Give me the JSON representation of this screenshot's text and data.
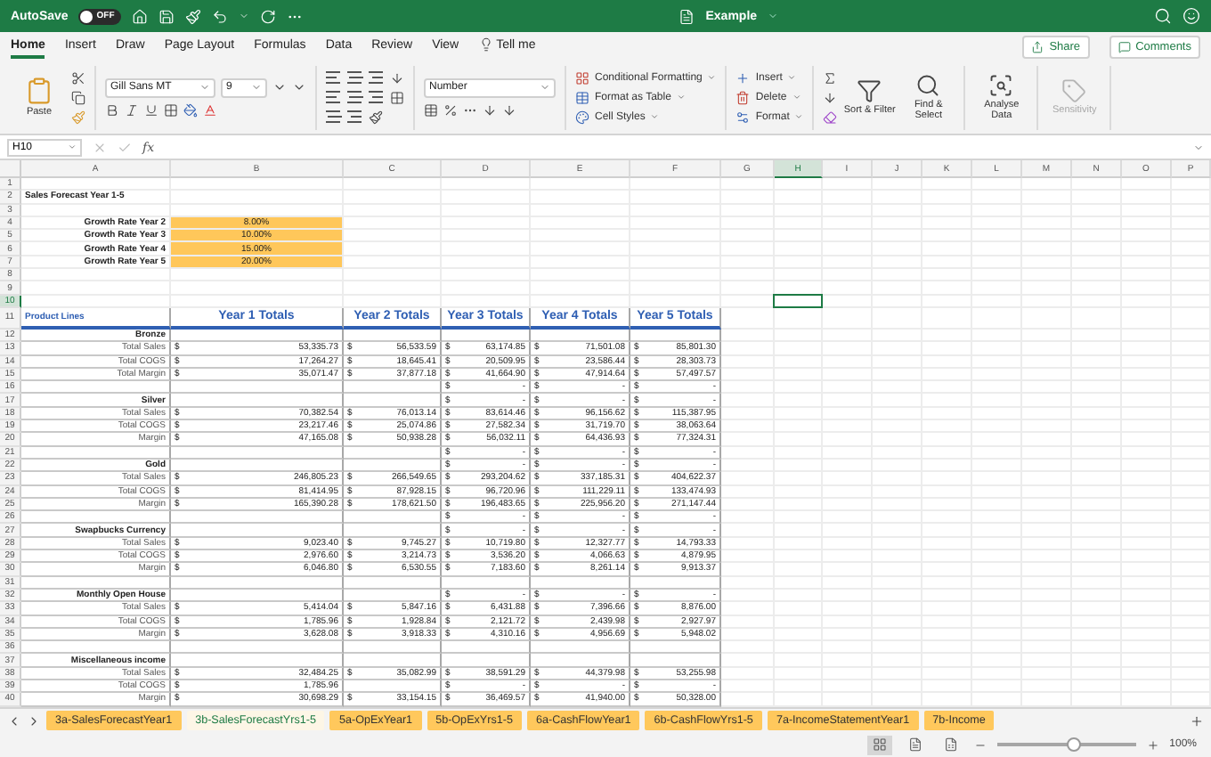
{
  "title_bar": {
    "autosave": "AutoSave",
    "autosave_on": false,
    "toggle_label": "OFF",
    "title": "Example"
  },
  "ribbon": {
    "tabs": [
      {
        "label": "Home",
        "selected": true
      },
      {
        "label": "Insert",
        "selected": false
      },
      {
        "label": "Draw",
        "selected": false
      },
      {
        "label": "Page Layout",
        "selected": false
      },
      {
        "label": "Formulas",
        "selected": false
      },
      {
        "label": "Data",
        "selected": false
      },
      {
        "label": "Review",
        "selected": false
      },
      {
        "label": "View",
        "selected": false
      },
      {
        "label": "Tell me",
        "selected": false
      }
    ],
    "share": "Share",
    "comments": "Comments",
    "paste": "Paste",
    "font": "Gill Sans MT",
    "font_size": "9",
    "number_format": "Number",
    "styles": [
      {
        "kind": "conditional",
        "label": "Conditional Formatting"
      },
      {
        "kind": "table",
        "label": "Format as Table"
      },
      {
        "kind": "cellstyles",
        "label": "Cell Styles"
      }
    ],
    "cells": [
      {
        "kind": "insert",
        "label": "Insert"
      },
      {
        "kind": "delete",
        "label": "Delete"
      },
      {
        "kind": "format",
        "label": "Format"
      }
    ],
    "big_buttons": [
      {
        "kind": "sort",
        "label": "Sort & Filter",
        "disabled": false
      },
      {
        "kind": "find",
        "label": "Find & Select",
        "disabled": false
      },
      {
        "kind": "analyse",
        "label": "Analyse Data",
        "disabled": false
      },
      {
        "kind": "sensitivity",
        "label": "Sensitivity",
        "disabled": true
      }
    ]
  },
  "formula_bar": {
    "name_box": "H10",
    "fx": "fx"
  },
  "sheet": {
    "columns": [
      {
        "label": "A",
        "selected": false
      },
      {
        "label": "B",
        "selected": false
      },
      {
        "label": "C",
        "selected": false
      },
      {
        "label": "D",
        "selected": false
      },
      {
        "label": "E",
        "selected": false
      },
      {
        "label": "F",
        "selected": false
      },
      {
        "label": "G",
        "selected": false
      },
      {
        "label": "H",
        "selected": true
      },
      {
        "label": "I",
        "selected": false
      },
      {
        "label": "J",
        "selected": false
      },
      {
        "label": "K",
        "selected": false
      },
      {
        "label": "L",
        "selected": false
      },
      {
        "label": "M",
        "selected": false
      },
      {
        "label": "N",
        "selected": false
      },
      {
        "label": "O",
        "selected": false
      },
      {
        "label": "P",
        "selected": false
      }
    ],
    "rows": [
      {
        "number": "1",
        "selected": false,
        "kind": "blank"
      },
      {
        "number": "2",
        "selected": false,
        "kind": "title",
        "text": "Sales Forecast Year 1-5"
      },
      {
        "number": "3",
        "selected": false,
        "kind": "blank"
      },
      {
        "number": "4",
        "selected": false,
        "kind": "rate",
        "label": "Growth Rate Year 2",
        "value": "8.00%"
      },
      {
        "number": "5",
        "selected": false,
        "kind": "rate",
        "label": "Growth Rate Year 3",
        "value": "10.00%"
      },
      {
        "number": "6",
        "selected": false,
        "kind": "rate",
        "label": "Growth Rate Year 4",
        "value": "15.00%"
      },
      {
        "number": "7",
        "selected": false,
        "kind": "rate",
        "label": "Growth Rate Year 5",
        "value": "20.00%"
      },
      {
        "number": "8",
        "selected": false,
        "kind": "blank"
      },
      {
        "number": "9",
        "selected": false,
        "kind": "blank"
      },
      {
        "number": "10",
        "selected": true,
        "kind": "blank"
      },
      {
        "number": "11",
        "selected": false,
        "kind": "header",
        "label": "Product Lines",
        "headers": [
          "Year 1 Totals",
          "Year 2 Totals",
          "Year 3 Totals",
          "Year 4 Totals",
          "Year 5 Totals"
        ]
      },
      {
        "number": "12",
        "selected": false,
        "kind": "group",
        "label": "Bronze"
      },
      {
        "number": "13",
        "selected": false,
        "kind": "data",
        "label": "Total Sales",
        "cells": [
          {
            "cur": "$",
            "v": "53,335.73"
          },
          {
            "cur": "$",
            "v": "56,533.59"
          },
          {
            "cur": "$",
            "v": "63,174.85"
          },
          {
            "cur": "$",
            "v": "71,501.08"
          },
          {
            "cur": "$",
            "v": "85,801.30"
          }
        ]
      },
      {
        "number": "14",
        "selected": false,
        "kind": "data",
        "label": "Total COGS",
        "cells": [
          {
            "cur": "$",
            "v": "17,264.27"
          },
          {
            "cur": "$",
            "v": "18,645.41"
          },
          {
            "cur": "$",
            "v": "20,509.95"
          },
          {
            "cur": "$",
            "v": "23,586.44"
          },
          {
            "cur": "$",
            "v": "28,303.73"
          }
        ]
      },
      {
        "number": "15",
        "selected": false,
        "kind": "data",
        "label": "Total Margin",
        "cells": [
          {
            "cur": "$",
            "v": "35,071.47"
          },
          {
            "cur": "$",
            "v": "37,877.18"
          },
          {
            "cur": "$",
            "v": "41,664.90"
          },
          {
            "cur": "$",
            "v": "47,914.64"
          },
          {
            "cur": "$",
            "v": "57,497.57"
          }
        ]
      },
      {
        "number": "16",
        "selected": false,
        "kind": "data",
        "cells": [
          null,
          null,
          {
            "cur": "$",
            "v": "-"
          },
          {
            "cur": "$",
            "v": "-"
          },
          {
            "cur": "$",
            "v": "-"
          }
        ]
      },
      {
        "number": "17",
        "selected": false,
        "kind": "group",
        "label": "Silver",
        "cells": [
          null,
          null,
          {
            "cur": "$",
            "v": "-"
          },
          {
            "cur": "$",
            "v": "-"
          },
          {
            "cur": "$",
            "v": "-"
          }
        ]
      },
      {
        "number": "18",
        "selected": false,
        "kind": "data",
        "label": "Total Sales",
        "cells": [
          {
            "cur": "$",
            "v": "70,382.54"
          },
          {
            "cur": "$",
            "v": "76,013.14"
          },
          {
            "cur": "$",
            "v": "83,614.46"
          },
          {
            "cur": "$",
            "v": "96,156.62"
          },
          {
            "cur": "$",
            "v": "115,387.95"
          }
        ]
      },
      {
        "number": "19",
        "selected": false,
        "kind": "data",
        "label": "Total COGS",
        "cells": [
          {
            "cur": "$",
            "v": "23,217.46"
          },
          {
            "cur": "$",
            "v": "25,074.86"
          },
          {
            "cur": "$",
            "v": "27,582.34"
          },
          {
            "cur": "$",
            "v": "31,719.70"
          },
          {
            "cur": "$",
            "v": "38,063.64"
          }
        ]
      },
      {
        "number": "20",
        "selected": false,
        "kind": "data",
        "label": "Margin",
        "cells": [
          {
            "cur": "$",
            "v": "47,165.08"
          },
          {
            "cur": "$",
            "v": "50,938.28"
          },
          {
            "cur": "$",
            "v": "56,032.11"
          },
          {
            "cur": "$",
            "v": "64,436.93"
          },
          {
            "cur": "$",
            "v": "77,324.31"
          }
        ]
      },
      {
        "number": "21",
        "selected": false,
        "kind": "data",
        "cells": [
          null,
          null,
          {
            "cur": "$",
            "v": "-"
          },
          {
            "cur": "$",
            "v": "-"
          },
          {
            "cur": "$",
            "v": "-"
          }
        ]
      },
      {
        "number": "22",
        "selected": false,
        "kind": "group",
        "label": "Gold",
        "cells": [
          null,
          null,
          {
            "cur": "$",
            "v": "-"
          },
          {
            "cur": "$",
            "v": "-"
          },
          {
            "cur": "$",
            "v": "-"
          }
        ]
      },
      {
        "number": "23",
        "selected": false,
        "kind": "data",
        "label": "Total Sales",
        "cells": [
          {
            "cur": "$",
            "v": "246,805.23"
          },
          {
            "cur": "$",
            "v": "266,549.65"
          },
          {
            "cur": "$",
            "v": "293,204.62"
          },
          {
            "cur": "$",
            "v": "337,185.31"
          },
          {
            "cur": "$",
            "v": "404,622.37"
          }
        ]
      },
      {
        "number": "24",
        "selected": false,
        "kind": "data",
        "label": "Total COGS",
        "cells": [
          {
            "cur": "$",
            "v": "81,414.95"
          },
          {
            "cur": "$",
            "v": "87,928.15"
          },
          {
            "cur": "$",
            "v": "96,720.96"
          },
          {
            "cur": "$",
            "v": "111,229.11"
          },
          {
            "cur": "$",
            "v": "133,474.93"
          }
        ]
      },
      {
        "number": "25",
        "selected": false,
        "kind": "data",
        "label": "Margin",
        "cells": [
          {
            "cur": "$",
            "v": "165,390.28"
          },
          {
            "cur": "$",
            "v": "178,621.50"
          },
          {
            "cur": "$",
            "v": "196,483.65"
          },
          {
            "cur": "$",
            "v": "225,956.20"
          },
          {
            "cur": "$",
            "v": "271,147.44"
          }
        ]
      },
      {
        "number": "26",
        "selected": false,
        "kind": "data",
        "cells": [
          null,
          null,
          {
            "cur": "$",
            "v": "-"
          },
          {
            "cur": "$",
            "v": "-"
          },
          {
            "cur": "$",
            "v": "-"
          }
        ]
      },
      {
        "number": "27",
        "selected": false,
        "kind": "group",
        "label": "Swapbucks Currency",
        "cells": [
          null,
          null,
          {
            "cur": "$",
            "v": "-"
          },
          {
            "cur": "$",
            "v": "-"
          },
          {
            "cur": "$",
            "v": "-"
          }
        ]
      },
      {
        "number": "28",
        "selected": false,
        "kind": "data",
        "label": "Total Sales",
        "cells": [
          {
            "cur": "$",
            "v": "9,023.40"
          },
          {
            "cur": "$",
            "v": "9,745.27"
          },
          {
            "cur": "$",
            "v": "10,719.80"
          },
          {
            "cur": "$",
            "v": "12,327.77"
          },
          {
            "cur": "$",
            "v": "14,793.33"
          }
        ]
      },
      {
        "number": "29",
        "selected": false,
        "kind": "data",
        "label": "Total COGS",
        "cells": [
          {
            "cur": "$",
            "v": "2,976.60"
          },
          {
            "cur": "$",
            "v": "3,214.73"
          },
          {
            "cur": "$",
            "v": "3,536.20"
          },
          {
            "cur": "$",
            "v": "4,066.63"
          },
          {
            "cur": "$",
            "v": "4,879.95"
          }
        ]
      },
      {
        "number": "30",
        "selected": false,
        "kind": "data",
        "label": "Margin",
        "cells": [
          {
            "cur": "$",
            "v": "6,046.80"
          },
          {
            "cur": "$",
            "v": "6,530.55"
          },
          {
            "cur": "$",
            "v": "7,183.60"
          },
          {
            "cur": "$",
            "v": "8,261.14"
          },
          {
            "cur": "$",
            "v": "9,913.37"
          }
        ]
      },
      {
        "number": "31",
        "selected": false,
        "kind": "blank"
      },
      {
        "number": "32",
        "selected": false,
        "kind": "group",
        "label": "Monthly Open House",
        "cells": [
          null,
          null,
          {
            "cur": "$",
            "v": "-"
          },
          {
            "cur": "$",
            "v": "-"
          },
          {
            "cur": "$",
            "v": "-"
          }
        ]
      },
      {
        "number": "33",
        "selected": false,
        "kind": "data",
        "label": "Total Sales",
        "cells": [
          {
            "cur": "$",
            "v": "5,414.04"
          },
          {
            "cur": "$",
            "v": "5,847.16"
          },
          {
            "cur": "$",
            "v": "6,431.88"
          },
          {
            "cur": "$",
            "v": "7,396.66"
          },
          {
            "cur": "$",
            "v": "8,876.00"
          }
        ]
      },
      {
        "number": "34",
        "selected": false,
        "kind": "data",
        "label": "Total COGS",
        "cells": [
          {
            "cur": "$",
            "v": "1,785.96"
          },
          {
            "cur": "$",
            "v": "1,928.84"
          },
          {
            "cur": "$",
            "v": "2,121.72"
          },
          {
            "cur": "$",
            "v": "2,439.98"
          },
          {
            "cur": "$",
            "v": "2,927.97"
          }
        ]
      },
      {
        "number": "35",
        "selected": false,
        "kind": "data",
        "label": "Margin",
        "cells": [
          {
            "cur": "$",
            "v": "3,628.08"
          },
          {
            "cur": "$",
            "v": "3,918.33"
          },
          {
            "cur": "$",
            "v": "4,310.16"
          },
          {
            "cur": "$",
            "v": "4,956.69"
          },
          {
            "cur": "$",
            "v": "5,948.02"
          }
        ]
      },
      {
        "number": "36",
        "selected": false,
        "kind": "blank"
      },
      {
        "number": "37",
        "selected": false,
        "kind": "group",
        "label": "Miscellaneous income"
      },
      {
        "number": "38",
        "selected": false,
        "kind": "data",
        "label": "Total Sales",
        "cells": [
          {
            "cur": "$",
            "v": "32,484.25"
          },
          {
            "cur": "$",
            "v": "35,082.99"
          },
          {
            "cur": "$",
            "v": "38,591.29"
          },
          {
            "cur": "$",
            "v": "44,379.98"
          },
          {
            "cur": "$",
            "v": "53,255.98"
          }
        ]
      },
      {
        "number": "39",
        "selected": false,
        "kind": "data",
        "label": "Total COGS",
        "cells": [
          {
            "cur": "$",
            "v": "1,785.96"
          },
          null,
          {
            "cur": "$",
            "v": "-"
          },
          {
            "cur": "$",
            "v": "-"
          },
          {
            "cur": "$",
            "v": "-"
          }
        ]
      },
      {
        "number": "40",
        "selected": false,
        "kind": "data",
        "label": "Margin",
        "cells": [
          {
            "cur": "$",
            "v": "30,698.29"
          },
          {
            "cur": "$",
            "v": "33,154.15"
          },
          {
            "cur": "$",
            "v": "36,469.57"
          },
          {
            "cur": "$",
            "v": "41,940.00"
          },
          {
            "cur": "$",
            "v": "50,328.00"
          }
        ]
      }
    ]
  },
  "sheet_tabs": [
    {
      "label": "3a-SalesForecastYear1",
      "selected": false
    },
    {
      "label": "3b-SalesForecastYrs1-5",
      "selected": true
    },
    {
      "label": "5a-OpExYear1",
      "selected": false
    },
    {
      "label": "5b-OpExYrs1-5",
      "selected": false
    },
    {
      "label": "6a-CashFlowYear1",
      "selected": false
    },
    {
      "label": "6b-CashFlowYrs1-5",
      "selected": false
    },
    {
      "label": "7a-IncomeStatementYear1",
      "selected": false
    },
    {
      "label": "7b-Income",
      "selected": false
    }
  ],
  "status_bar": {
    "views": [
      {
        "kind": "normal",
        "selected": true
      },
      {
        "kind": "page_layout",
        "selected": false
      },
      {
        "kind": "page_break",
        "selected": false
      }
    ],
    "zoom": {
      "level": 0.55,
      "reading": "100%"
    }
  }
}
